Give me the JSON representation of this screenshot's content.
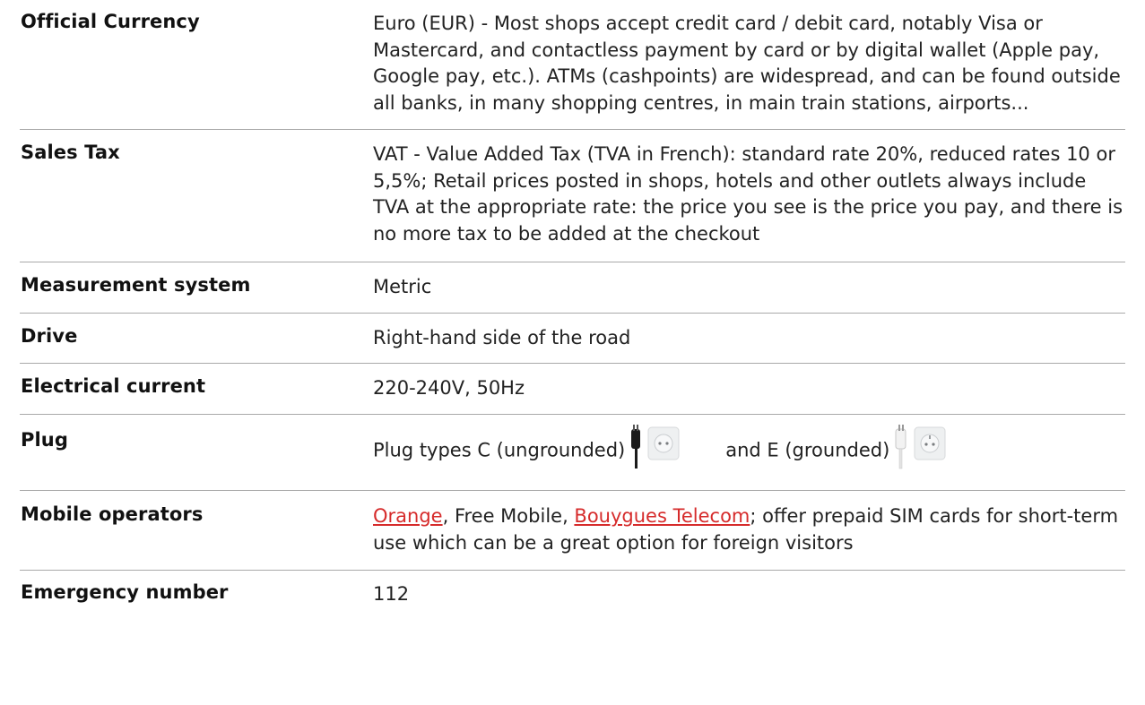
{
  "rows": [
    {
      "label": "Official Currency",
      "value": "Euro (EUR) - Most shops accept credit card / debit card, notably Visa or Mastercard, and contactless payment by card or by digital wallet (Apple pay, Google pay, etc.). ATMs (cashpoints) are widespread, and can be found outside all banks, in many shopping centres, in main train stations, airports..."
    },
    {
      "label": "Sales Tax",
      "value": "VAT - Value Added Tax (TVA in French): standard rate 20%, reduced rates 10 or 5,5%; Retail prices posted in shops, hotels and other outlets always include TVA at the appropriate rate: the price you see is the price you pay, and there is no more tax to be added at the checkout"
    },
    {
      "label": "Measurement system",
      "value": "Metric"
    },
    {
      "label": "Drive",
      "value": "Right-hand side of the road"
    },
    {
      "label": "Electrical current",
      "value": "220-240V, 50Hz"
    },
    {
      "label": "Plug",
      "value_part1": "Plug types C (ungrounded)",
      "value_part2": "and E (grounded)"
    },
    {
      "label": "Mobile operators",
      "link1": "Orange",
      "text1": ", Free Mobile, ",
      "link2": "Bouygues Telecom",
      "text2": "; offer prepaid SIM cards for short-term use which can be a great option for foreign visitors"
    },
    {
      "label": "Emergency number",
      "value": "112"
    }
  ],
  "colors": {
    "link": "#d62b2b",
    "divider": "#a9a9a9",
    "text": "#222222"
  },
  "icons": [
    "plug-c-socket-icon",
    "plug-e-socket-icon"
  ]
}
